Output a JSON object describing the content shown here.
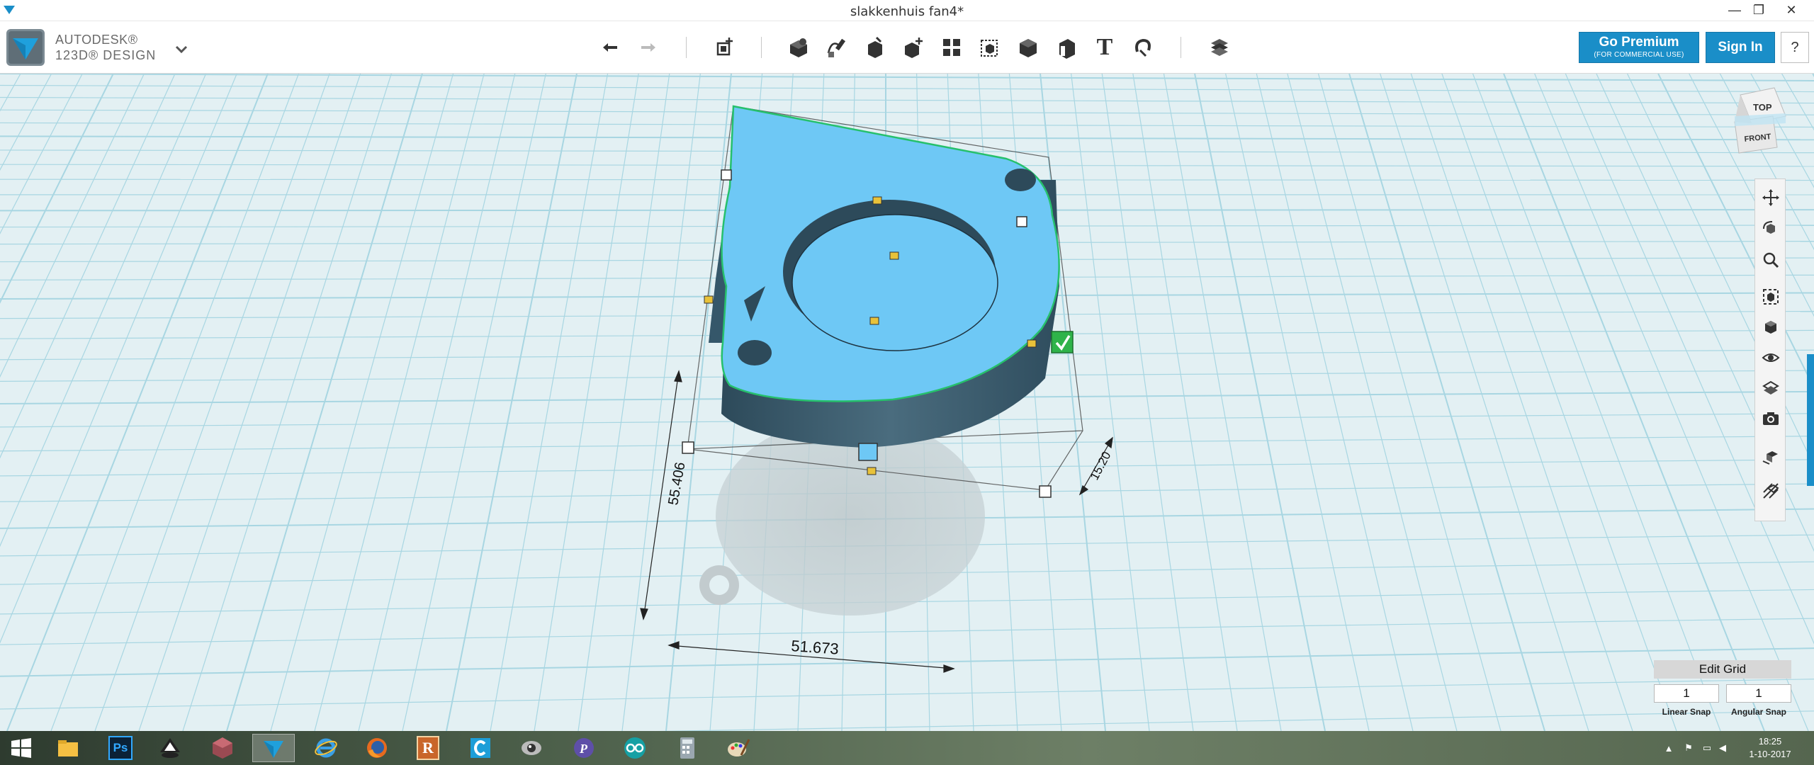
{
  "window": {
    "title": "slakkenhuis fan4*",
    "minimize": "—",
    "restore": "❐",
    "close": "✕"
  },
  "app": {
    "brand_line1": "AUTODESK®",
    "brand_line2": "123D® DESIGN"
  },
  "toolbar": {
    "tools": [
      "undo-icon",
      "redo-icon",
      "transform-icon",
      "primitives-icon",
      "sketch-icon",
      "construct-icon",
      "modify-icon",
      "pattern-icon",
      "grouping-icon",
      "combine-icon",
      "measure-icon",
      "text-icon",
      "snap-icon",
      "material-icon"
    ],
    "text_tool_glyph": "T"
  },
  "account": {
    "premium_label": "Go Premium",
    "premium_sub": "(FOR COMMERCIAL USE)",
    "signin_label": "Sign In",
    "help_label": "?"
  },
  "viewcube": {
    "top_label": "TOP",
    "front_label": "FRONT"
  },
  "dimensions": {
    "length": "55.406",
    "width": "51.673",
    "height": "15.20"
  },
  "navbar": {
    "items": [
      "pan-icon",
      "orbit-icon",
      "zoom-icon",
      "fit-icon",
      "views-icon",
      "visibility-icon",
      "material-view-icon",
      "screenshot-icon",
      "grid-icon",
      "wireframe-icon"
    ]
  },
  "grid": {
    "edit_label": "Edit Grid",
    "linear_snap_value": "1",
    "angular_snap_value": "1",
    "linear_snap_label": "Linear Snap",
    "angular_snap_label": "Angular Snap"
  },
  "taskbar": {
    "apps": [
      "start-icon",
      "file-explorer-icon",
      "photoshop-icon",
      "inkscape-icon",
      "meshmixer-icon",
      "123d-design-icon",
      "internet-explorer-icon",
      "firefox-icon",
      "reaper-icon",
      "ccleaner-icon",
      "app-eye-icon",
      "app-p-icon",
      "arduino-icon",
      "calculator-icon",
      "paint-icon"
    ],
    "photoshop_glyph": "Ps",
    "reaper_glyph": "R",
    "time": "18:25",
    "date": "1-10-2017"
  },
  "colors": {
    "accent": "#1a8ec8",
    "model_top": "#6ec8f5",
    "model_side": "#3a5a6b",
    "grid_bg": "#dfeef1",
    "grid_line": "#9fd0de",
    "confirm": "#2fb34a"
  }
}
